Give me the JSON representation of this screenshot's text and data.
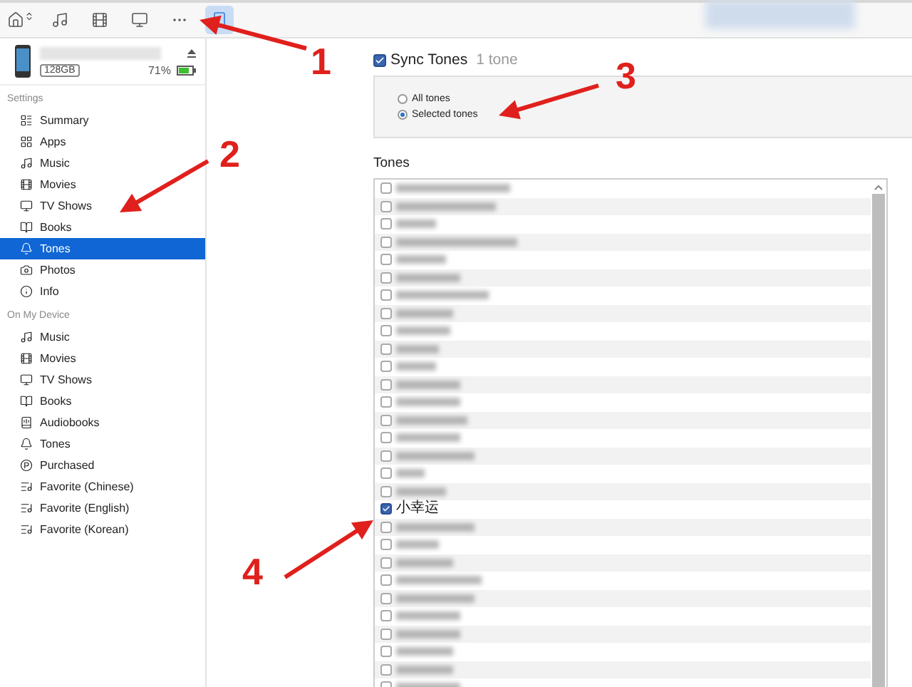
{
  "toolbar": [
    {
      "kind": "device-menu",
      "selected": false
    },
    {
      "kind": "music",
      "selected": false
    },
    {
      "kind": "movies",
      "selected": false
    },
    {
      "kind": "tv",
      "selected": false
    },
    {
      "kind": "more",
      "selected": false
    },
    {
      "kind": "phone",
      "selected": true
    }
  ],
  "device": {
    "capacity": "128GB",
    "battery": "71%"
  },
  "sidebar": {
    "sections": [
      {
        "title": "Settings",
        "items": [
          {
            "label": "Summary",
            "kind": "summary",
            "selected": false
          },
          {
            "label": "Apps",
            "kind": "apps",
            "selected": false
          },
          {
            "label": "Music",
            "kind": "music",
            "selected": false
          },
          {
            "label": "Movies",
            "kind": "movies",
            "selected": false
          },
          {
            "label": "TV Shows",
            "kind": "tv",
            "selected": false
          },
          {
            "label": "Books",
            "kind": "books",
            "selected": false
          },
          {
            "label": "Tones",
            "kind": "tones",
            "selected": true
          },
          {
            "label": "Photos",
            "kind": "photos",
            "selected": false
          },
          {
            "label": "Info",
            "kind": "info",
            "selected": false
          }
        ]
      },
      {
        "title": "On My Device",
        "items": [
          {
            "label": "Music",
            "kind": "music",
            "selected": false
          },
          {
            "label": "Movies",
            "kind": "movies",
            "selected": false
          },
          {
            "label": "TV Shows",
            "kind": "tv",
            "selected": false
          },
          {
            "label": "Books",
            "kind": "books",
            "selected": false
          },
          {
            "label": "Audiobooks",
            "kind": "audiobooks",
            "selected": false
          },
          {
            "label": "Tones",
            "kind": "tones",
            "selected": false
          },
          {
            "label": "Purchased",
            "kind": "purchased",
            "selected": false
          },
          {
            "label": "Favorite (Chinese)",
            "kind": "playlist",
            "selected": false
          },
          {
            "label": "Favorite (English)",
            "kind": "playlist",
            "selected": false
          },
          {
            "label": "Favorite (Korean)",
            "kind": "playlist",
            "selected": false
          }
        ]
      }
    ]
  },
  "sync": {
    "label": "Sync Tones",
    "count": "1 tone",
    "checked": true,
    "options": [
      {
        "label": "All tones",
        "selected": false
      },
      {
        "label": "Selected tones",
        "selected": true
      }
    ]
  },
  "tones": {
    "title": "Tones",
    "rows": [
      {
        "kind": "blurred",
        "checked": false
      },
      {
        "kind": "blurred",
        "checked": false
      },
      {
        "kind": "blurred",
        "checked": false
      },
      {
        "kind": "blurred",
        "checked": false
      },
      {
        "kind": "blurred",
        "checked": false
      },
      {
        "kind": "blurred",
        "checked": false
      },
      {
        "kind": "blurred",
        "checked": false
      },
      {
        "kind": "blurred",
        "checked": false
      },
      {
        "kind": "blurred",
        "checked": false
      },
      {
        "kind": "blurred",
        "checked": false
      },
      {
        "kind": "blurred",
        "checked": false
      },
      {
        "kind": "blurred",
        "checked": false
      },
      {
        "kind": "blurred",
        "checked": false
      },
      {
        "kind": "blurred",
        "checked": false
      },
      {
        "kind": "blurred",
        "checked": false
      },
      {
        "kind": "blurred",
        "checked": false
      },
      {
        "kind": "blurred",
        "checked": false
      },
      {
        "kind": "blurred",
        "checked": false
      },
      {
        "kind": "text",
        "name": "小幸运",
        "checked": true
      },
      {
        "kind": "blurred",
        "checked": false
      },
      {
        "kind": "blurred",
        "checked": false
      },
      {
        "kind": "blurred",
        "checked": false
      },
      {
        "kind": "blurred",
        "checked": false
      },
      {
        "kind": "blurred",
        "checked": false
      },
      {
        "kind": "blurred",
        "checked": false
      },
      {
        "kind": "blurred",
        "checked": false
      },
      {
        "kind": "blurred",
        "checked": false
      },
      {
        "kind": "blurred",
        "checked": false
      },
      {
        "kind": "blurred",
        "checked": false
      }
    ]
  },
  "annotations": [
    {
      "label": "1"
    },
    {
      "label": "2"
    },
    {
      "label": "3"
    },
    {
      "label": "4"
    }
  ]
}
